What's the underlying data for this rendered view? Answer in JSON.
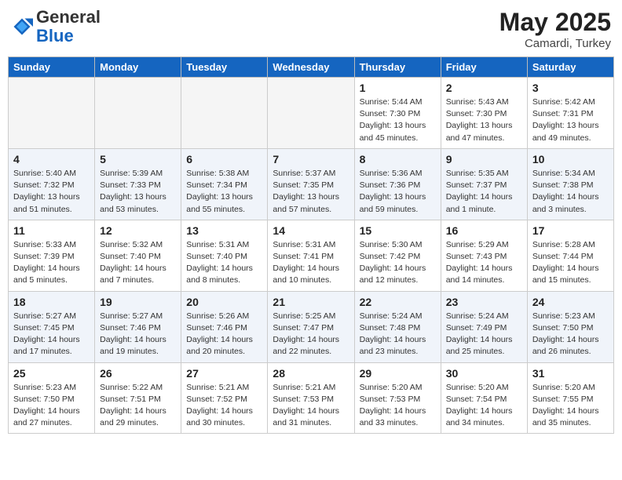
{
  "header": {
    "logo_general": "General",
    "logo_blue": "Blue",
    "month_year": "May 2025",
    "location": "Camardi, Turkey"
  },
  "days_of_week": [
    "Sunday",
    "Monday",
    "Tuesday",
    "Wednesday",
    "Thursday",
    "Friday",
    "Saturday"
  ],
  "weeks": [
    [
      {
        "day": "",
        "info": ""
      },
      {
        "day": "",
        "info": ""
      },
      {
        "day": "",
        "info": ""
      },
      {
        "day": "",
        "info": ""
      },
      {
        "day": "1",
        "info": "Sunrise: 5:44 AM\nSunset: 7:30 PM\nDaylight: 13 hours\nand 45 minutes."
      },
      {
        "day": "2",
        "info": "Sunrise: 5:43 AM\nSunset: 7:30 PM\nDaylight: 13 hours\nand 47 minutes."
      },
      {
        "day": "3",
        "info": "Sunrise: 5:42 AM\nSunset: 7:31 PM\nDaylight: 13 hours\nand 49 minutes."
      }
    ],
    [
      {
        "day": "4",
        "info": "Sunrise: 5:40 AM\nSunset: 7:32 PM\nDaylight: 13 hours\nand 51 minutes."
      },
      {
        "day": "5",
        "info": "Sunrise: 5:39 AM\nSunset: 7:33 PM\nDaylight: 13 hours\nand 53 minutes."
      },
      {
        "day": "6",
        "info": "Sunrise: 5:38 AM\nSunset: 7:34 PM\nDaylight: 13 hours\nand 55 minutes."
      },
      {
        "day": "7",
        "info": "Sunrise: 5:37 AM\nSunset: 7:35 PM\nDaylight: 13 hours\nand 57 minutes."
      },
      {
        "day": "8",
        "info": "Sunrise: 5:36 AM\nSunset: 7:36 PM\nDaylight: 13 hours\nand 59 minutes."
      },
      {
        "day": "9",
        "info": "Sunrise: 5:35 AM\nSunset: 7:37 PM\nDaylight: 14 hours\nand 1 minute."
      },
      {
        "day": "10",
        "info": "Sunrise: 5:34 AM\nSunset: 7:38 PM\nDaylight: 14 hours\nand 3 minutes."
      }
    ],
    [
      {
        "day": "11",
        "info": "Sunrise: 5:33 AM\nSunset: 7:39 PM\nDaylight: 14 hours\nand 5 minutes."
      },
      {
        "day": "12",
        "info": "Sunrise: 5:32 AM\nSunset: 7:40 PM\nDaylight: 14 hours\nand 7 minutes."
      },
      {
        "day": "13",
        "info": "Sunrise: 5:31 AM\nSunset: 7:40 PM\nDaylight: 14 hours\nand 8 minutes."
      },
      {
        "day": "14",
        "info": "Sunrise: 5:31 AM\nSunset: 7:41 PM\nDaylight: 14 hours\nand 10 minutes."
      },
      {
        "day": "15",
        "info": "Sunrise: 5:30 AM\nSunset: 7:42 PM\nDaylight: 14 hours\nand 12 minutes."
      },
      {
        "day": "16",
        "info": "Sunrise: 5:29 AM\nSunset: 7:43 PM\nDaylight: 14 hours\nand 14 minutes."
      },
      {
        "day": "17",
        "info": "Sunrise: 5:28 AM\nSunset: 7:44 PM\nDaylight: 14 hours\nand 15 minutes."
      }
    ],
    [
      {
        "day": "18",
        "info": "Sunrise: 5:27 AM\nSunset: 7:45 PM\nDaylight: 14 hours\nand 17 minutes."
      },
      {
        "day": "19",
        "info": "Sunrise: 5:27 AM\nSunset: 7:46 PM\nDaylight: 14 hours\nand 19 minutes."
      },
      {
        "day": "20",
        "info": "Sunrise: 5:26 AM\nSunset: 7:46 PM\nDaylight: 14 hours\nand 20 minutes."
      },
      {
        "day": "21",
        "info": "Sunrise: 5:25 AM\nSunset: 7:47 PM\nDaylight: 14 hours\nand 22 minutes."
      },
      {
        "day": "22",
        "info": "Sunrise: 5:24 AM\nSunset: 7:48 PM\nDaylight: 14 hours\nand 23 minutes."
      },
      {
        "day": "23",
        "info": "Sunrise: 5:24 AM\nSunset: 7:49 PM\nDaylight: 14 hours\nand 25 minutes."
      },
      {
        "day": "24",
        "info": "Sunrise: 5:23 AM\nSunset: 7:50 PM\nDaylight: 14 hours\nand 26 minutes."
      }
    ],
    [
      {
        "day": "25",
        "info": "Sunrise: 5:23 AM\nSunset: 7:50 PM\nDaylight: 14 hours\nand 27 minutes."
      },
      {
        "day": "26",
        "info": "Sunrise: 5:22 AM\nSunset: 7:51 PM\nDaylight: 14 hours\nand 29 minutes."
      },
      {
        "day": "27",
        "info": "Sunrise: 5:21 AM\nSunset: 7:52 PM\nDaylight: 14 hours\nand 30 minutes."
      },
      {
        "day": "28",
        "info": "Sunrise: 5:21 AM\nSunset: 7:53 PM\nDaylight: 14 hours\nand 31 minutes."
      },
      {
        "day": "29",
        "info": "Sunrise: 5:20 AM\nSunset: 7:53 PM\nDaylight: 14 hours\nand 33 minutes."
      },
      {
        "day": "30",
        "info": "Sunrise: 5:20 AM\nSunset: 7:54 PM\nDaylight: 14 hours\nand 34 minutes."
      },
      {
        "day": "31",
        "info": "Sunrise: 5:20 AM\nSunset: 7:55 PM\nDaylight: 14 hours\nand 35 minutes."
      }
    ]
  ]
}
